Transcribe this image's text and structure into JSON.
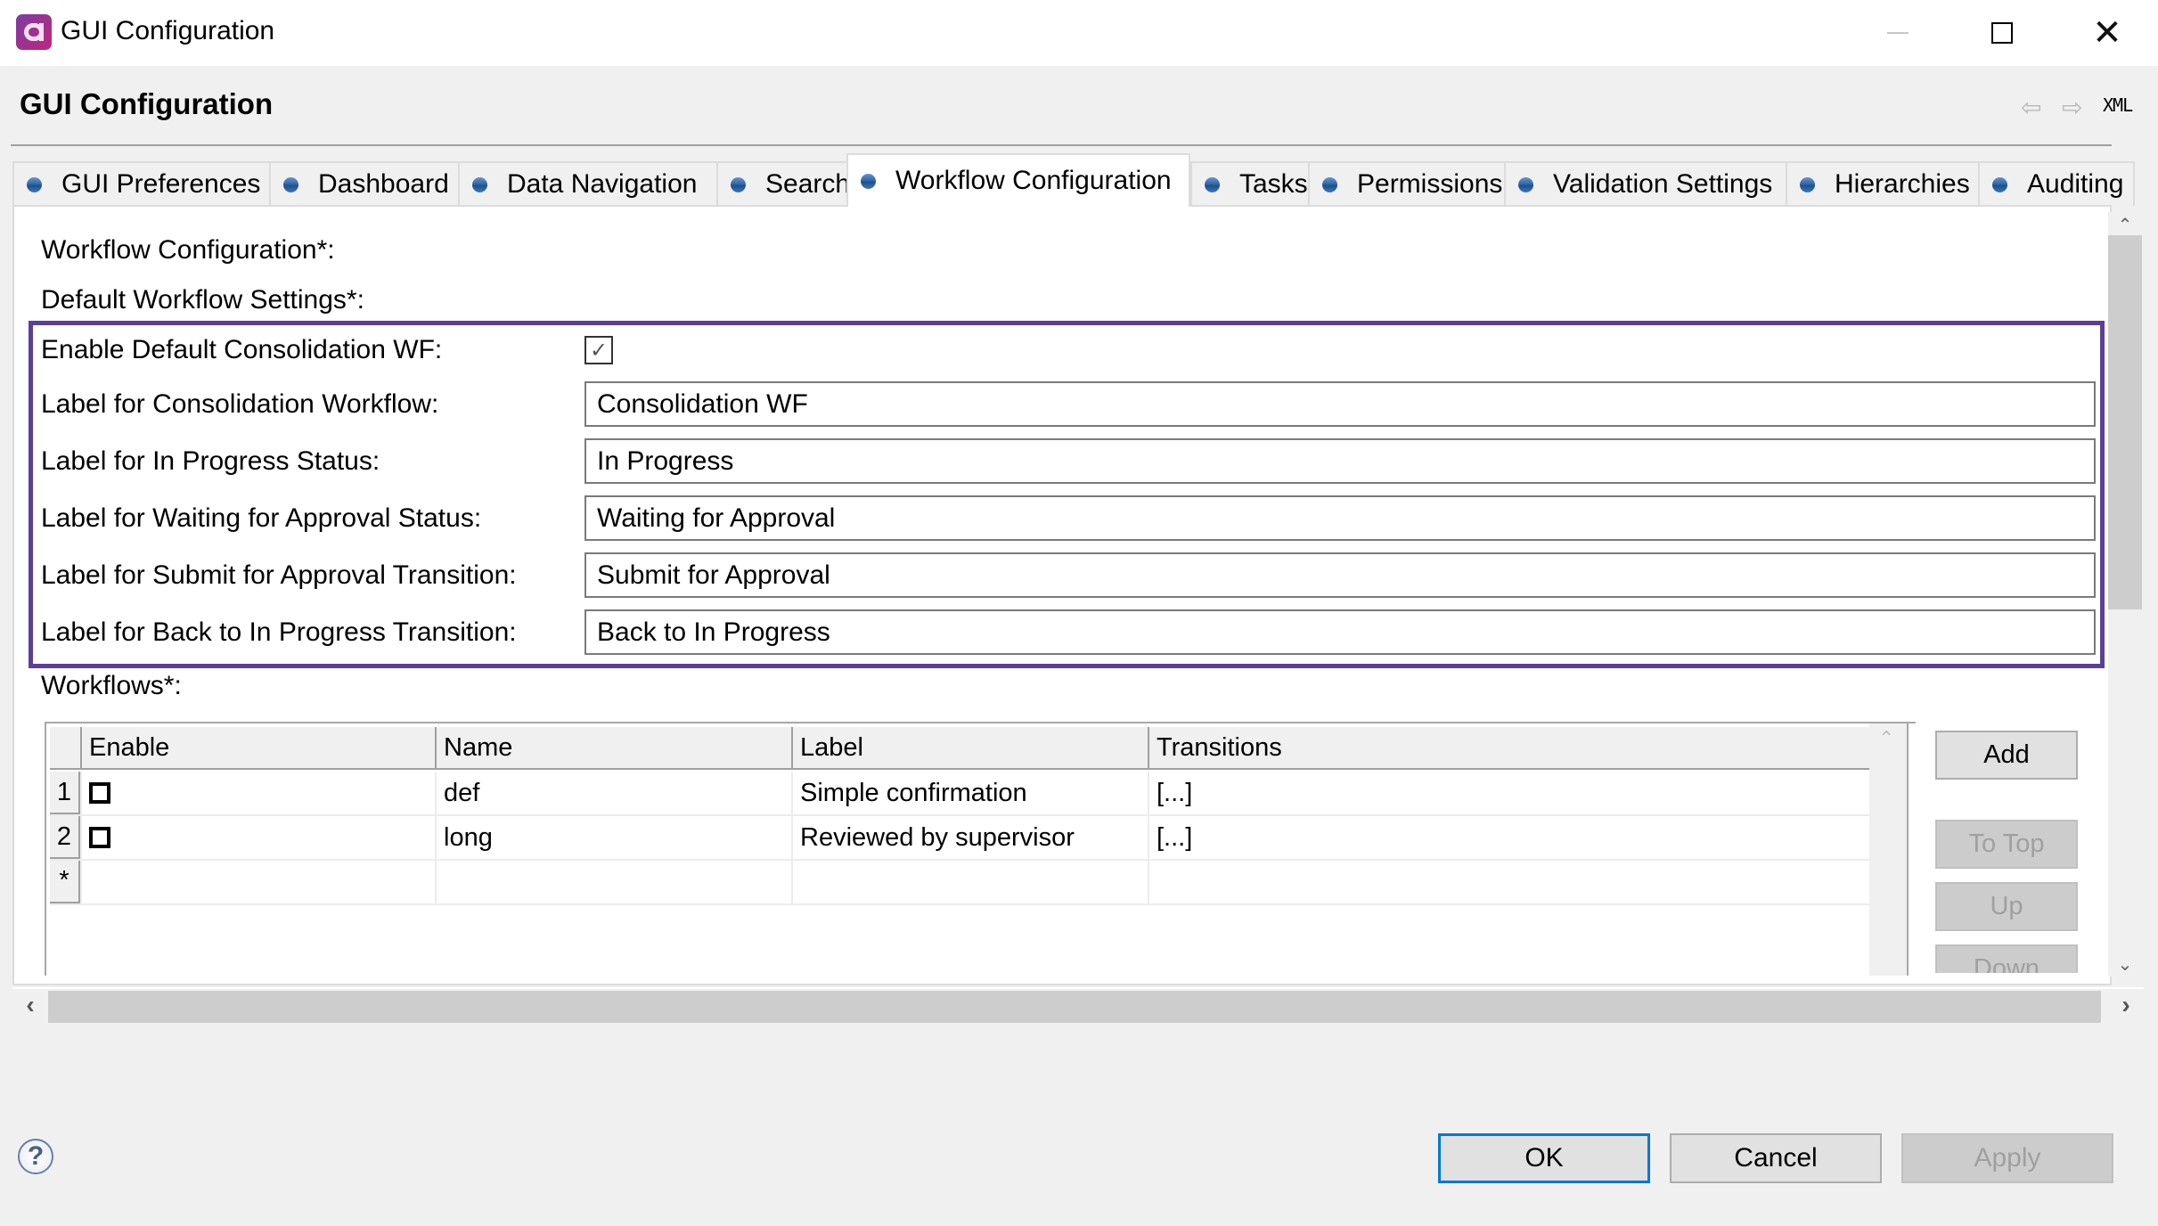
{
  "window": {
    "title": "GUI Configuration",
    "minimize_icon": "minimize-icon",
    "maximize_icon": "maximize-icon",
    "close_icon": "✕"
  },
  "header": {
    "title": "GUI Configuration",
    "back_icon": "⇦",
    "forward_icon": "⇨",
    "xml_label": "XML"
  },
  "tabs": [
    {
      "label": "GUI Preferences",
      "active": false
    },
    {
      "label": "Dashboard",
      "active": false
    },
    {
      "label": "Data Navigation",
      "active": false
    },
    {
      "label": "Search",
      "active": false
    },
    {
      "label": "Workflow Configuration",
      "active": true
    },
    {
      "label": "Tasks",
      "active": false
    },
    {
      "label": "Permissions",
      "active": false
    },
    {
      "label": "Validation Settings",
      "active": false
    },
    {
      "label": "Hierarchies",
      "active": false
    },
    {
      "label": "Auditing",
      "active": false
    }
  ],
  "panel": {
    "section_title": "Workflow Configuration*:",
    "default_settings_title": "Default Workflow Settings*:",
    "enable_default": {
      "label": "Enable Default Consolidation WF:",
      "checked": true,
      "check_glyph": "✓"
    },
    "fields": [
      {
        "label": "Label for Consolidation Workflow:",
        "value": "Consolidation WF"
      },
      {
        "label": "Label for In Progress Status:",
        "value": "In Progress"
      },
      {
        "label": "Label for Waiting for Approval Status:",
        "value": "Waiting for Approval"
      },
      {
        "label": "Label for Submit for Approval Transition:",
        "value": "Submit for Approval"
      },
      {
        "label": "Label for Back to In Progress Transition:",
        "value": "Back to In Progress"
      }
    ],
    "workflows_title": "Workflows*:",
    "table": {
      "columns": [
        "Enable",
        "Name",
        "Label",
        "Transitions"
      ],
      "rows": [
        {
          "num": "1",
          "enable": false,
          "name": "def",
          "label": "Simple confirmation",
          "transitions": "[...]"
        },
        {
          "num": "2",
          "enable": false,
          "name": "long",
          "label": "Reviewed by supervisor",
          "transitions": "[...]"
        }
      ],
      "new_row_marker": "*"
    },
    "buttons": {
      "add": "Add",
      "to_top": "To Top",
      "up": "Up",
      "down": "Down"
    },
    "scroll_up": "⌃",
    "scroll_down": "⌄",
    "scroll_left": "‹",
    "scroll_right": "›"
  },
  "footer": {
    "help_glyph": "?",
    "ok": "OK",
    "cancel": "Cancel",
    "apply": "Apply",
    "apply_enabled": false
  },
  "colors": {
    "highlight_border": "#5a4099",
    "default_button_border": "#0078d7",
    "tab_dot": "#2f67aa"
  }
}
